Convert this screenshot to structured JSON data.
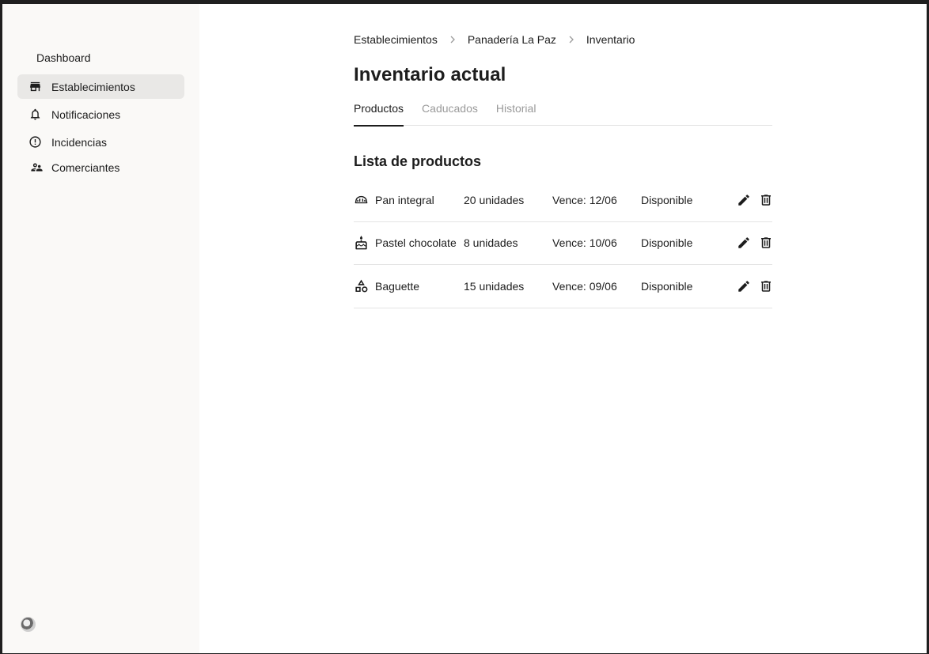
{
  "sidebar": {
    "dashboard_label": "Dashboard",
    "items": [
      {
        "label": "Establecimientos",
        "icon": "store-icon",
        "active": true
      },
      {
        "label": "Notificaciones",
        "icon": "bell-icon",
        "active": false
      },
      {
        "label": "Incidencias",
        "icon": "alert-circle-icon",
        "active": false
      },
      {
        "label": "Comerciantes",
        "icon": "people-icon",
        "active": false
      }
    ]
  },
  "breadcrumb": [
    "Establecimientos",
    "Panadería La Paz",
    "Inventario"
  ],
  "page_title": "Inventario actual",
  "tabs": [
    {
      "label": "Productos",
      "active": true
    },
    {
      "label": "Caducados",
      "active": false
    },
    {
      "label": "Historial",
      "active": false
    }
  ],
  "section_title": "Lista de productos",
  "products": [
    {
      "icon": "bread-icon",
      "name": "Pan integral",
      "quantity": "20 unidades",
      "expires": "Vence: 12/06",
      "status": "Disponible"
    },
    {
      "icon": "cake-icon",
      "name": "Pastel chocolate",
      "quantity": "8 unidades",
      "expires": "Vence: 10/06",
      "status": "Disponible"
    },
    {
      "icon": "category-icon",
      "name": "Baguette",
      "quantity": "15 unidades",
      "expires": "Vence: 09/06",
      "status": "Disponible"
    }
  ],
  "colors": {
    "sidebar_bg": "#faf9f7",
    "active_item_bg": "#e9e8e6",
    "text": "#1d1d1d",
    "muted": "#9a9a9a",
    "divider": "#e4e4e4"
  }
}
